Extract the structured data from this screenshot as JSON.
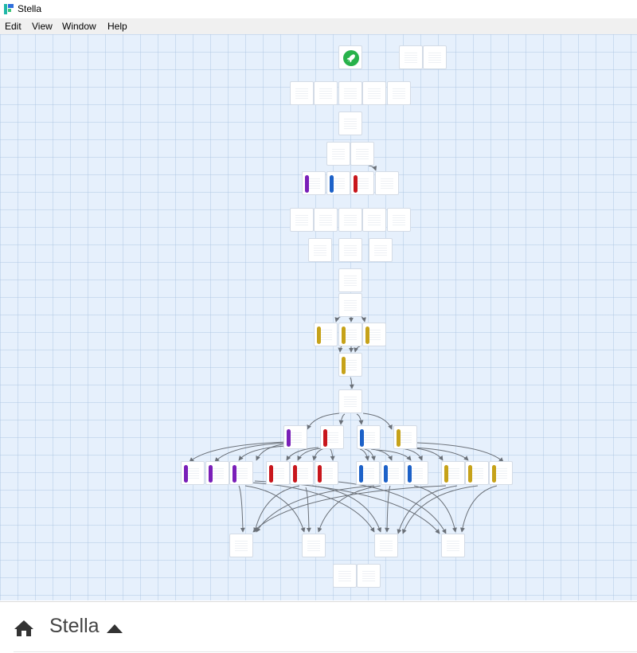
{
  "app": {
    "title": "Stella"
  },
  "menu": {
    "items": [
      {
        "label": "Edit"
      },
      {
        "label": "View"
      },
      {
        "label": "Window"
      },
      {
        "label": "Help"
      }
    ]
  },
  "colors": {
    "canvas": "#e6f0fc",
    "purple": "#7a1fb8",
    "blue": "#1c61c8",
    "red": "#c8161c",
    "gold": "#c6a219",
    "start": "#27b24a",
    "edge": "#6a7078"
  },
  "footer": {
    "project_name": "Stella",
    "home_icon": "home-icon",
    "collapse_icon": "caret-up-icon"
  }
}
